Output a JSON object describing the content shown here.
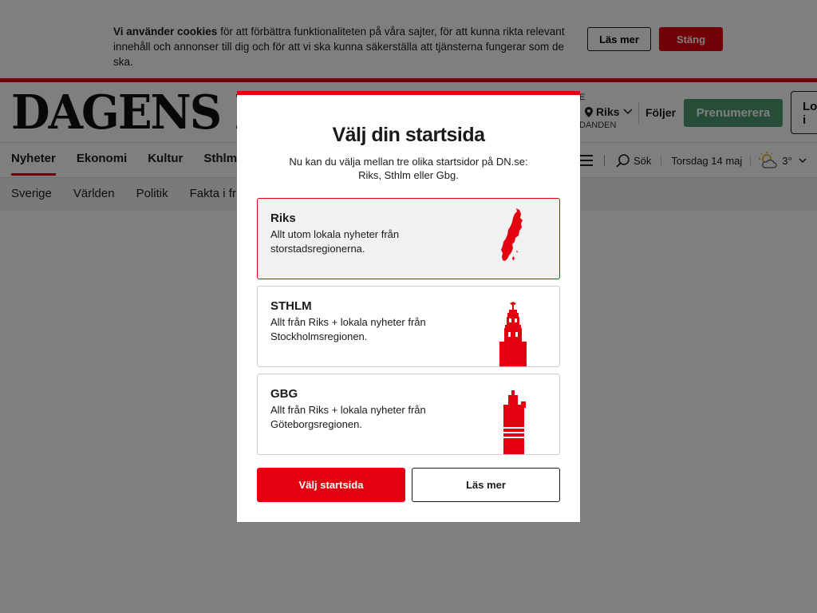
{
  "cookie": {
    "bold": "Vi använder cookies",
    "text": " för att förbättra funktionaliteten på våra sajter, för att kunna rikta relevant innehåll och annonser till dig och för att vi ska kunna säkerställa att tjänsterna fungerar som de ska.",
    "read_more": "Läs mer",
    "close": "Stäng"
  },
  "header": {
    "logo": "DAGENS NYHETER",
    "edition_top": "E",
    "edition": "Riks",
    "edition_bottom": "DANDEN",
    "follows": "Följer",
    "subscribe": "Prenumerera",
    "login": "Lo i"
  },
  "nav": {
    "items": [
      "Nyheter",
      "Ekonomi",
      "Kultur",
      "Sthlm"
    ],
    "search": "Sök",
    "date": "Torsdag 14 maj",
    "temperature": "3°"
  },
  "sub_nav": {
    "items": [
      "Sverige",
      "Världen",
      "Politik",
      "Fakta i fr"
    ]
  },
  "modal": {
    "title": "Välj din startsida",
    "description": "Nu kan du välja mellan tre olika startsidor på DN.se: Riks, Sthlm eller Gbg.",
    "options": [
      {
        "title": "Riks",
        "description": "Allt utom lokala nyheter från storstadsregionerna."
      },
      {
        "title": "STHLM",
        "description": "Allt från Riks + lokala nyheter från Stockholmsregionen."
      },
      {
        "title": "GBG",
        "description": "Allt från Riks + lokala nyheter från Göteborgsregionen."
      }
    ],
    "choose_button": "Välj startsida",
    "read_more_button": "Läs mer"
  },
  "colors": {
    "brand_red": "#e3000f",
    "subscribe_green": "#4a9a6f"
  }
}
